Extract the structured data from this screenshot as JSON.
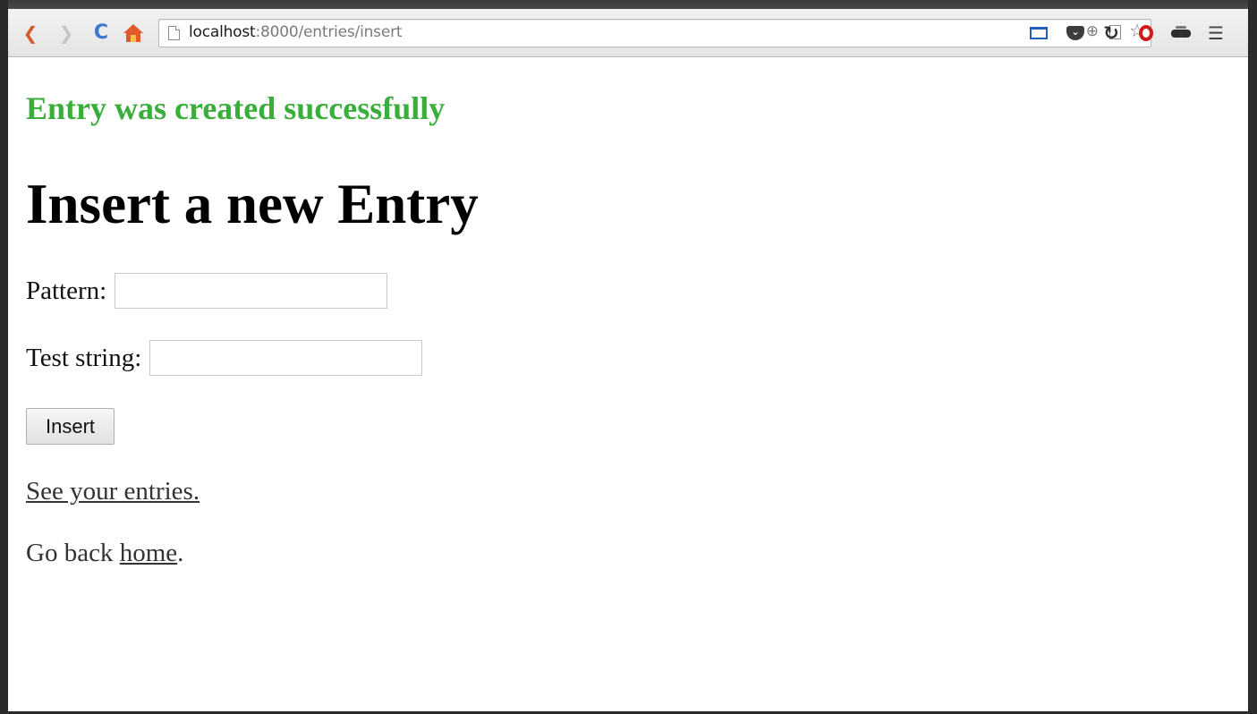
{
  "browser": {
    "url_host": "localhost",
    "url_path": ":8000/entries/insert",
    "icons": [
      "back-icon",
      "forward-icon",
      "reload-icon",
      "home-icon",
      "page-icon",
      "zoom-icon",
      "page-action-icon",
      "star-icon",
      "cast-icon",
      "pocket-icon",
      "refresh-extension-icon",
      "opera-icon",
      "glasses-extension-icon",
      "menu-icon"
    ]
  },
  "page": {
    "flash_message": "Entry was created successfully",
    "title": "Insert a new Entry",
    "form": {
      "pattern_label": "Pattern:",
      "pattern_value": "",
      "test_string_label": "Test string:",
      "test_string_value": "",
      "submit_label": "Insert"
    },
    "entries_link": "See your entries.",
    "go_back_prefix": "Go back ",
    "home_link": "home",
    "go_back_suffix": "."
  },
  "colors": {
    "flash_text": "#3aae3a",
    "link_text": "#333333"
  }
}
